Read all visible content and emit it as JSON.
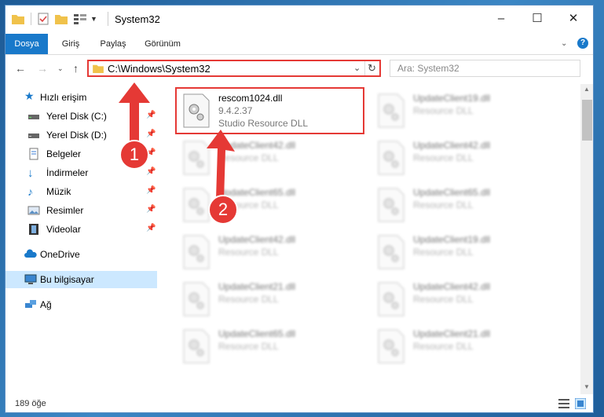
{
  "window": {
    "title": "System32",
    "caption_buttons": [
      "–",
      "☐",
      "✕"
    ]
  },
  "ribbon": {
    "tabs": [
      "Dosya",
      "Giriş",
      "Paylaş",
      "Görünüm"
    ],
    "help": "?"
  },
  "nav": {
    "address": "C:\\Windows\\System32",
    "search_placeholder": "Ara: System32"
  },
  "sidebar": {
    "quick_access": "Hızlı erişim",
    "items": [
      {
        "label": "Yerel Disk (C:)",
        "icon": "drive-icon"
      },
      {
        "label": "Yerel Disk (D:)",
        "icon": "drive-icon"
      },
      {
        "label": "Belgeler",
        "icon": "documents-icon"
      },
      {
        "label": "İndirmeler",
        "icon": "downloads-icon"
      },
      {
        "label": "Müzik",
        "icon": "music-icon"
      },
      {
        "label": "Resimler",
        "icon": "pictures-icon"
      },
      {
        "label": "Videolar",
        "icon": "videos-icon"
      }
    ],
    "onedrive": "OneDrive",
    "this_pc": "Bu bilgisayar",
    "network": "Ağ"
  },
  "files": {
    "highlighted": {
      "name": "rescom1024.dll",
      "version": "9.4.2.37",
      "description": "Studio Resource DLL"
    },
    "left_column": [
      {
        "name": "UpdateClient42.dll",
        "desc": "Resource DLL"
      },
      {
        "name": "UpdateClient65.dll",
        "desc": "Resource DLL"
      },
      {
        "name": "UpdateClient42.dll",
        "desc": "Resource DLL"
      },
      {
        "name": "UpdateClient21.dll",
        "desc": "Resource DLL"
      },
      {
        "name": "UpdateClient65.dll",
        "desc": "Resource DLL"
      }
    ],
    "right_column": [
      {
        "name": "UpdateClient19.dll",
        "desc": "Resource DLL"
      },
      {
        "name": "UpdateClient42.dll",
        "desc": "Resource DLL"
      },
      {
        "name": "UpdateClient65.dll",
        "desc": "Resource DLL"
      },
      {
        "name": "UpdateClient19.dll",
        "desc": "Resource DLL"
      },
      {
        "name": "UpdateClient42.dll",
        "desc": "Resource DLL"
      },
      {
        "name": "UpdateClient21.dll",
        "desc": "Resource DLL"
      }
    ]
  },
  "status": {
    "count": "189 öğe"
  },
  "callouts": [
    "1",
    "2"
  ],
  "colors": {
    "accent": "#1979ca",
    "highlight": "#e53935",
    "selected": "#cce8ff"
  }
}
